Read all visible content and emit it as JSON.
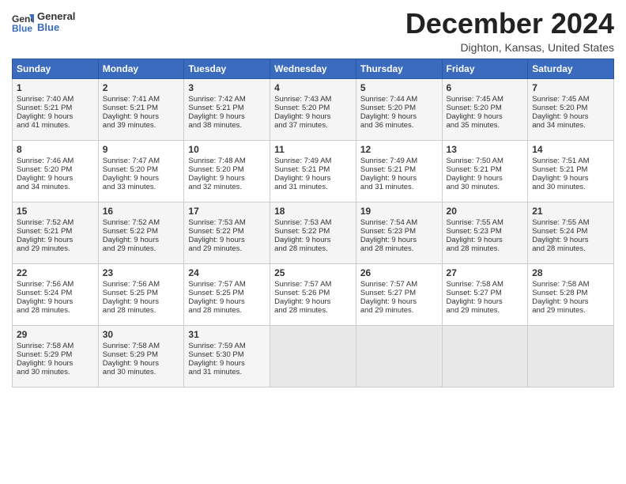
{
  "header": {
    "logo_line1": "General",
    "logo_line2": "Blue",
    "month_title": "December 2024",
    "location": "Dighton, Kansas, United States"
  },
  "days_of_week": [
    "Sunday",
    "Monday",
    "Tuesday",
    "Wednesday",
    "Thursday",
    "Friday",
    "Saturday"
  ],
  "weeks": [
    [
      {
        "day": "1",
        "lines": [
          "Sunrise: 7:40 AM",
          "Sunset: 5:21 PM",
          "Daylight: 9 hours",
          "and 41 minutes."
        ]
      },
      {
        "day": "2",
        "lines": [
          "Sunrise: 7:41 AM",
          "Sunset: 5:21 PM",
          "Daylight: 9 hours",
          "and 39 minutes."
        ]
      },
      {
        "day": "3",
        "lines": [
          "Sunrise: 7:42 AM",
          "Sunset: 5:21 PM",
          "Daylight: 9 hours",
          "and 38 minutes."
        ]
      },
      {
        "day": "4",
        "lines": [
          "Sunrise: 7:43 AM",
          "Sunset: 5:20 PM",
          "Daylight: 9 hours",
          "and 37 minutes."
        ]
      },
      {
        "day": "5",
        "lines": [
          "Sunrise: 7:44 AM",
          "Sunset: 5:20 PM",
          "Daylight: 9 hours",
          "and 36 minutes."
        ]
      },
      {
        "day": "6",
        "lines": [
          "Sunrise: 7:45 AM",
          "Sunset: 5:20 PM",
          "Daylight: 9 hours",
          "and 35 minutes."
        ]
      },
      {
        "day": "7",
        "lines": [
          "Sunrise: 7:45 AM",
          "Sunset: 5:20 PM",
          "Daylight: 9 hours",
          "and 34 minutes."
        ]
      }
    ],
    [
      {
        "day": "8",
        "lines": [
          "Sunrise: 7:46 AM",
          "Sunset: 5:20 PM",
          "Daylight: 9 hours",
          "and 34 minutes."
        ]
      },
      {
        "day": "9",
        "lines": [
          "Sunrise: 7:47 AM",
          "Sunset: 5:20 PM",
          "Daylight: 9 hours",
          "and 33 minutes."
        ]
      },
      {
        "day": "10",
        "lines": [
          "Sunrise: 7:48 AM",
          "Sunset: 5:20 PM",
          "Daylight: 9 hours",
          "and 32 minutes."
        ]
      },
      {
        "day": "11",
        "lines": [
          "Sunrise: 7:49 AM",
          "Sunset: 5:21 PM",
          "Daylight: 9 hours",
          "and 31 minutes."
        ]
      },
      {
        "day": "12",
        "lines": [
          "Sunrise: 7:49 AM",
          "Sunset: 5:21 PM",
          "Daylight: 9 hours",
          "and 31 minutes."
        ]
      },
      {
        "day": "13",
        "lines": [
          "Sunrise: 7:50 AM",
          "Sunset: 5:21 PM",
          "Daylight: 9 hours",
          "and 30 minutes."
        ]
      },
      {
        "day": "14",
        "lines": [
          "Sunrise: 7:51 AM",
          "Sunset: 5:21 PM",
          "Daylight: 9 hours",
          "and 30 minutes."
        ]
      }
    ],
    [
      {
        "day": "15",
        "lines": [
          "Sunrise: 7:52 AM",
          "Sunset: 5:21 PM",
          "Daylight: 9 hours",
          "and 29 minutes."
        ]
      },
      {
        "day": "16",
        "lines": [
          "Sunrise: 7:52 AM",
          "Sunset: 5:22 PM",
          "Daylight: 9 hours",
          "and 29 minutes."
        ]
      },
      {
        "day": "17",
        "lines": [
          "Sunrise: 7:53 AM",
          "Sunset: 5:22 PM",
          "Daylight: 9 hours",
          "and 29 minutes."
        ]
      },
      {
        "day": "18",
        "lines": [
          "Sunrise: 7:53 AM",
          "Sunset: 5:22 PM",
          "Daylight: 9 hours",
          "and 28 minutes."
        ]
      },
      {
        "day": "19",
        "lines": [
          "Sunrise: 7:54 AM",
          "Sunset: 5:23 PM",
          "Daylight: 9 hours",
          "and 28 minutes."
        ]
      },
      {
        "day": "20",
        "lines": [
          "Sunrise: 7:55 AM",
          "Sunset: 5:23 PM",
          "Daylight: 9 hours",
          "and 28 minutes."
        ]
      },
      {
        "day": "21",
        "lines": [
          "Sunrise: 7:55 AM",
          "Sunset: 5:24 PM",
          "Daylight: 9 hours",
          "and 28 minutes."
        ]
      }
    ],
    [
      {
        "day": "22",
        "lines": [
          "Sunrise: 7:56 AM",
          "Sunset: 5:24 PM",
          "Daylight: 9 hours",
          "and 28 minutes."
        ]
      },
      {
        "day": "23",
        "lines": [
          "Sunrise: 7:56 AM",
          "Sunset: 5:25 PM",
          "Daylight: 9 hours",
          "and 28 minutes."
        ]
      },
      {
        "day": "24",
        "lines": [
          "Sunrise: 7:57 AM",
          "Sunset: 5:25 PM",
          "Daylight: 9 hours",
          "and 28 minutes."
        ]
      },
      {
        "day": "25",
        "lines": [
          "Sunrise: 7:57 AM",
          "Sunset: 5:26 PM",
          "Daylight: 9 hours",
          "and 28 minutes."
        ]
      },
      {
        "day": "26",
        "lines": [
          "Sunrise: 7:57 AM",
          "Sunset: 5:27 PM",
          "Daylight: 9 hours",
          "and 29 minutes."
        ]
      },
      {
        "day": "27",
        "lines": [
          "Sunrise: 7:58 AM",
          "Sunset: 5:27 PM",
          "Daylight: 9 hours",
          "and 29 minutes."
        ]
      },
      {
        "day": "28",
        "lines": [
          "Sunrise: 7:58 AM",
          "Sunset: 5:28 PM",
          "Daylight: 9 hours",
          "and 29 minutes."
        ]
      }
    ],
    [
      {
        "day": "29",
        "lines": [
          "Sunrise: 7:58 AM",
          "Sunset: 5:29 PM",
          "Daylight: 9 hours",
          "and 30 minutes."
        ]
      },
      {
        "day": "30",
        "lines": [
          "Sunrise: 7:58 AM",
          "Sunset: 5:29 PM",
          "Daylight: 9 hours",
          "and 30 minutes."
        ]
      },
      {
        "day": "31",
        "lines": [
          "Sunrise: 7:59 AM",
          "Sunset: 5:30 PM",
          "Daylight: 9 hours",
          "and 31 minutes."
        ]
      },
      null,
      null,
      null,
      null
    ]
  ]
}
